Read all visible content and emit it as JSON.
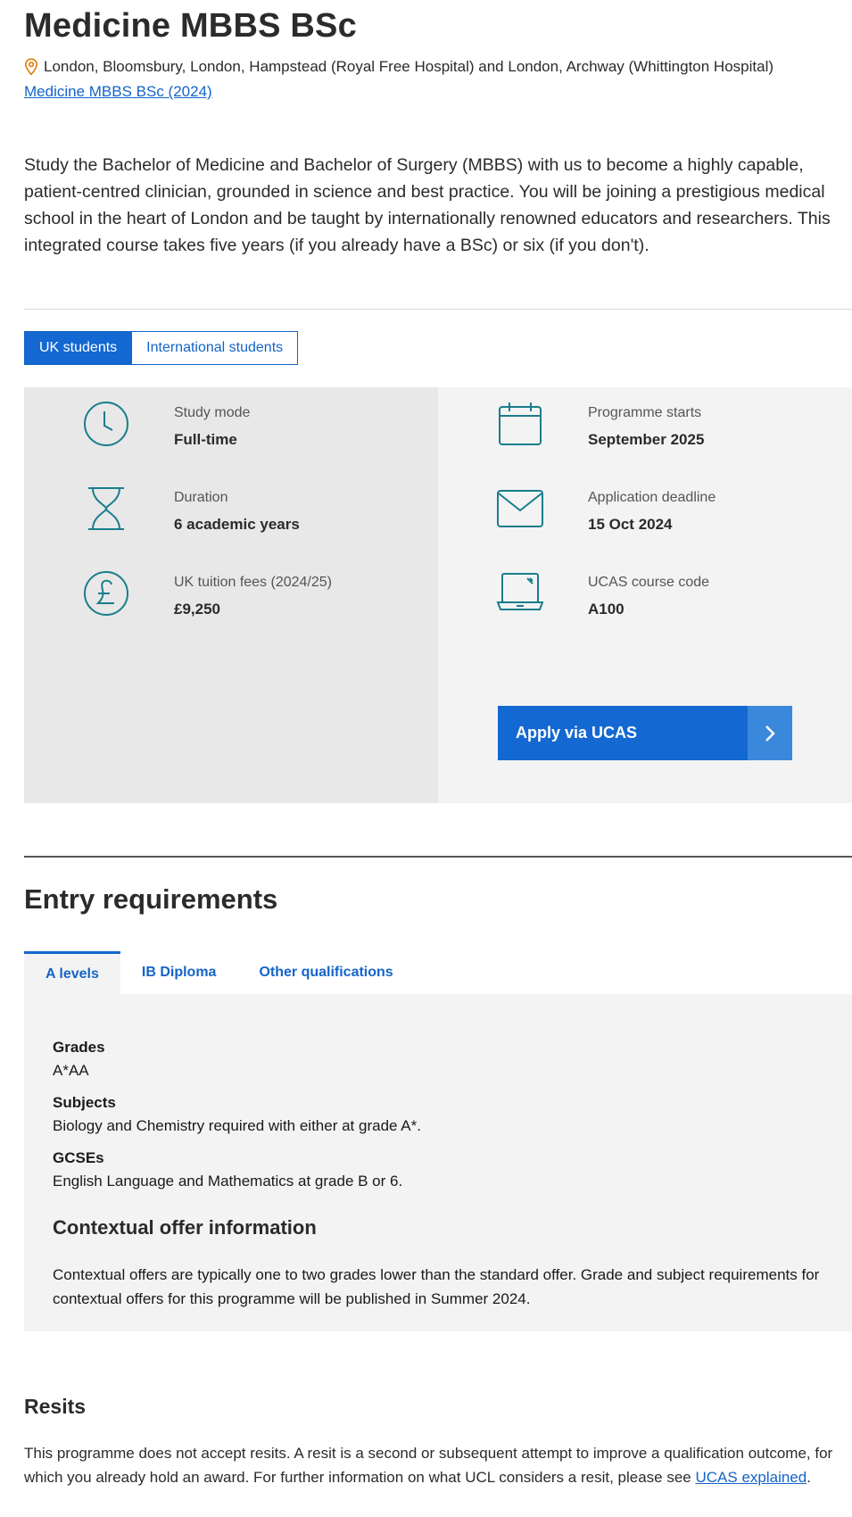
{
  "header": {
    "title": "Medicine MBBS BSc",
    "location": "London, Bloomsbury, London, Hampstead (Royal Free Hospital) and London, Archway (Whittington Hospital)",
    "previous_link": "Medicine MBBS BSc (2024)"
  },
  "intro": "Study the Bachelor of Medicine and Bachelor of Surgery (MBBS) with us to become a highly capable, patient-centred clinician, grounded in science and best practice. You will be joining a prestigious medical school in the heart of London and be taught by internationally renowned educators and researchers. This integrated course takes five years (if you already have a BSc) or six (if you don't).",
  "student_tabs": [
    {
      "label": "UK students",
      "active": true
    },
    {
      "label": "International students",
      "active": false
    }
  ],
  "facts": {
    "study_mode": {
      "label": "Study mode",
      "value": "Full-time",
      "icon": "clock-icon"
    },
    "duration": {
      "label": "Duration",
      "value": "6 academic years",
      "icon": "hourglass-icon"
    },
    "fees": {
      "label": "UK tuition fees (2024/25)",
      "value": "£9,250",
      "icon": "pound-icon"
    },
    "starts": {
      "label": "Programme starts",
      "value": "September 2025",
      "icon": "calendar-icon"
    },
    "deadline": {
      "label": "Application deadline",
      "value": "15 Oct 2024",
      "icon": "envelope-icon"
    },
    "ucas": {
      "label": "UCAS course code",
      "value": "A100",
      "icon": "laptop-icon"
    }
  },
  "apply_button": "Apply via UCAS",
  "entry": {
    "heading": "Entry requirements",
    "tabs": [
      {
        "label": "A levels",
        "active": true
      },
      {
        "label": "IB Diploma",
        "active": false
      },
      {
        "label": "Other qualifications",
        "active": false
      }
    ],
    "grades_label": "Grades",
    "grades_value": "A*AA",
    "subjects_label": "Subjects",
    "subjects_value": "Biology and Chemistry required with either at grade A*.",
    "gcses_label": "GCSEs",
    "gcses_value": "English Language and Mathematics at grade B or 6.",
    "contextual_heading": "Contextual offer information",
    "contextual_text": "Contextual offers are typically one to two grades lower than the standard offer. Grade and subject requirements for contextual offers for this programme will be published in Summer 2024."
  },
  "resits": {
    "heading": "Resits",
    "text": "This programme does not accept resits. A resit is a second or subsequent attempt to improve a qualification outcome, for which you already hold an award. For further information on what UCL considers a resit, please see ",
    "link": "UCAS explained",
    "end": "."
  },
  "colors": {
    "accent": "#1368d1",
    "link": "#1464c8",
    "icon_teal": "#1a7d8c",
    "pin_orange": "#e07b00"
  }
}
